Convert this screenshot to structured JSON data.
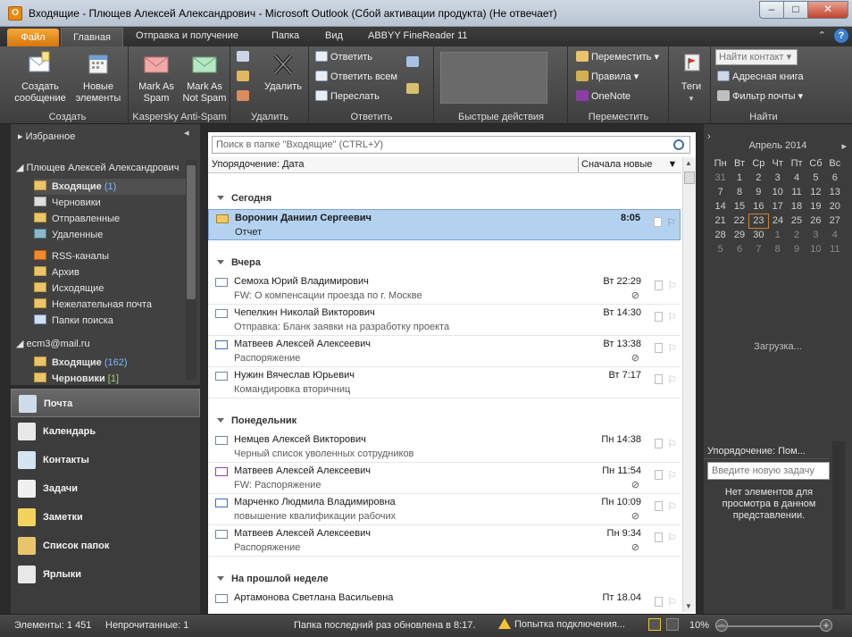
{
  "window": {
    "app_icon": "O",
    "title": "Входящие - Плющев Алексей Александрович - Microsoft Outlook (Сбой активации продукта) (Не отвечает)",
    "minimize": "–",
    "maximize": "□",
    "close": "✕"
  },
  "ribbon_tabs": {
    "file": "Файл",
    "home": "Главная",
    "send_receive": "Отправка и получение",
    "folder": "Папка",
    "view": "Вид",
    "abbyy": "ABBYY FineReader 11",
    "help": "?"
  },
  "ribbon": {
    "create": {
      "new_message": "Создать сообщение",
      "new_items": "Новые элементы",
      "label": "Создать"
    },
    "spam": {
      "mark_spam": "Mark As Spam",
      "not_spam": "Mark As Not Spam",
      "label": "Kaspersky Anti-Spam"
    },
    "delete": {
      "delete": "Удалить",
      "label": "Удалить"
    },
    "reply": {
      "reply": "Ответить",
      "reply_all": "Ответить всем",
      "forward": "Переслать",
      "label": "Ответить"
    },
    "quick": {
      "label": "Быстрые действия"
    },
    "move": {
      "move": "Переместить",
      "rules": "Правила",
      "onenote": "OneNote",
      "label": "Переместить"
    },
    "tags": {
      "tags": "Теги"
    },
    "find": {
      "find_contact": "Найти контакт",
      "address_book": "Адресная книга",
      "filter": "Фильтр почты",
      "label": "Найти"
    }
  },
  "nav": {
    "favorites": "Избранное",
    "account1": "Плющев Алексей Александрович",
    "folders1": [
      {
        "name": "Входящие",
        "count": "(1)",
        "bold": true,
        "selected": true
      },
      {
        "name": "Черновики"
      },
      {
        "name": "Отправленные"
      },
      {
        "name": "Удаленные"
      },
      {
        "name": "RSS-каналы"
      },
      {
        "name": "Архив"
      },
      {
        "name": "Исходящие"
      },
      {
        "name": "Нежелательная почта"
      },
      {
        "name": "Папки поиска"
      }
    ],
    "account2": "ecm3@mail.ru",
    "folders2": [
      {
        "name": "Входящие",
        "count": "(162)"
      },
      {
        "name": "Черновики",
        "count": "[1]"
      }
    ],
    "buttons": {
      "mail": "Почта",
      "calendar": "Календарь",
      "contacts": "Контакты",
      "tasks": "Задачи",
      "notes": "Заметки",
      "folders": "Список папок",
      "shortcuts": "Ярлыки"
    }
  },
  "list": {
    "search_placeholder": "Поиск в папке \"Входящие\" (CTRL+У)",
    "arrange": "Упорядочение: Дата",
    "order": "Сначала новые",
    "groups": {
      "today": "Сегодня",
      "yesterday": "Вчера",
      "monday": "Понедельник",
      "last_week": "На прошлой неделе"
    },
    "messages": [
      {
        "from": "Воронин Даниил Сергеевич",
        "subject": "Отчет",
        "date": "8:05"
      },
      {
        "from": "Семоха Юрий Владимирович",
        "subject": "FW: О компенсации проезда по г. Москве",
        "date": "Вт 22:29"
      },
      {
        "from": "Чепелкин Николай Викторович",
        "subject": "Отправка: Бланк заявки на разработку проекта",
        "date": "Вт 14:30"
      },
      {
        "from": "Матвеев Алексей Алексеевич",
        "subject": "Распоряжение",
        "date": "Вт 13:38"
      },
      {
        "from": "Нужин Вячеслав Юрьевич",
        "subject": "Командировка вторичниц",
        "date": "Вт 7:17"
      },
      {
        "from": "Немцев Алексей Викторович",
        "subject": "Черный список уволенных сотрудников",
        "date": "Пн 14:38"
      },
      {
        "from": "Матвеев Алексей Алексеевич",
        "subject": "FW: Распоряжение",
        "date": "Пн 11:54"
      },
      {
        "from": "Марченко Людмила Владимировна",
        "subject": "повышение квалификации рабочих",
        "date": "Пн 10:09"
      },
      {
        "from": "Матвеев Алексей Алексеевич",
        "subject": "Распоряжение",
        "date": "Пн 9:34"
      },
      {
        "from": "Артамонова Светлана Васильевна",
        "subject": "",
        "date": "Пт 18.04"
      }
    ]
  },
  "calendar": {
    "title": "Апрель 2014",
    "days": [
      "Пн",
      "Вт",
      "Ср",
      "Чт",
      "Пт",
      "Сб",
      "Вс"
    ],
    "weeks": [
      [
        "31",
        "1",
        "2",
        "3",
        "4",
        "5",
        "6"
      ],
      [
        "7",
        "8",
        "9",
        "10",
        "11",
        "12",
        "13"
      ],
      [
        "14",
        "15",
        "16",
        "17",
        "18",
        "19",
        "20"
      ],
      [
        "21",
        "22",
        "23",
        "24",
        "25",
        "26",
        "27"
      ],
      [
        "28",
        "29",
        "30",
        "1",
        "2",
        "3",
        "4"
      ],
      [
        "5",
        "6",
        "7",
        "8",
        "9",
        "10",
        "11"
      ]
    ],
    "loading": "Загрузка..."
  },
  "todo": {
    "arrange": "Упорядочение: Пом...",
    "new_task_placeholder": "Введите новую задачу",
    "empty": "Нет элементов для просмотра в данном представлении."
  },
  "status": {
    "items": "Элементы: 1 451",
    "unread": "Непрочитанные: 1",
    "updated": "Папка последний раз обновлена в 8:17.",
    "connecting": "Попытка подключения...",
    "zoom": "10%"
  }
}
